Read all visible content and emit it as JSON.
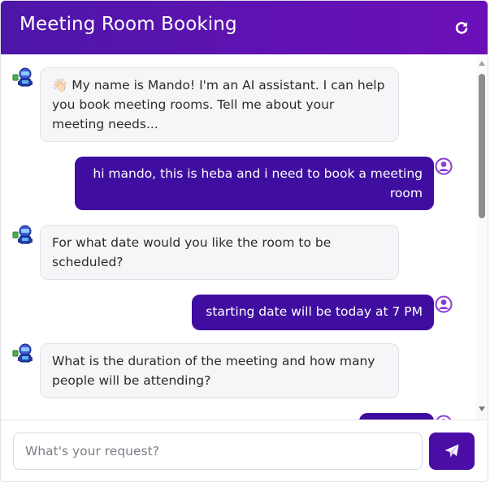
{
  "header": {
    "title": "Meeting Room Booking",
    "refresh_icon": "refresh-icon"
  },
  "messages": [
    {
      "sender": "bot",
      "emoji": "👋🏻",
      "text": "My name is Mando! I'm an AI assistant. I can help you book meeting rooms. Tell me about your meeting needs..."
    },
    {
      "sender": "user",
      "text": "hi mando, this is heba and i need to book a meeting room"
    },
    {
      "sender": "bot",
      "text": "For what date would you like the room to be scheduled?"
    },
    {
      "sender": "user",
      "text": "starting date will be today at 7 PM"
    },
    {
      "sender": "bot",
      "text": "What is the duration of the meeting and how many people will be attending?"
    }
  ],
  "composer": {
    "placeholder": "What's your request?",
    "value": "",
    "send_icon": "paper-plane-icon"
  },
  "colors": {
    "header_gradient_start": "#4d16a8",
    "header_gradient_end": "#6b10b8",
    "user_bubble": "#3f0ea0",
    "bot_bubble": "#f5f6f8",
    "send_button": "#4a0ea6",
    "user_avatar": "#8a3bd6"
  }
}
